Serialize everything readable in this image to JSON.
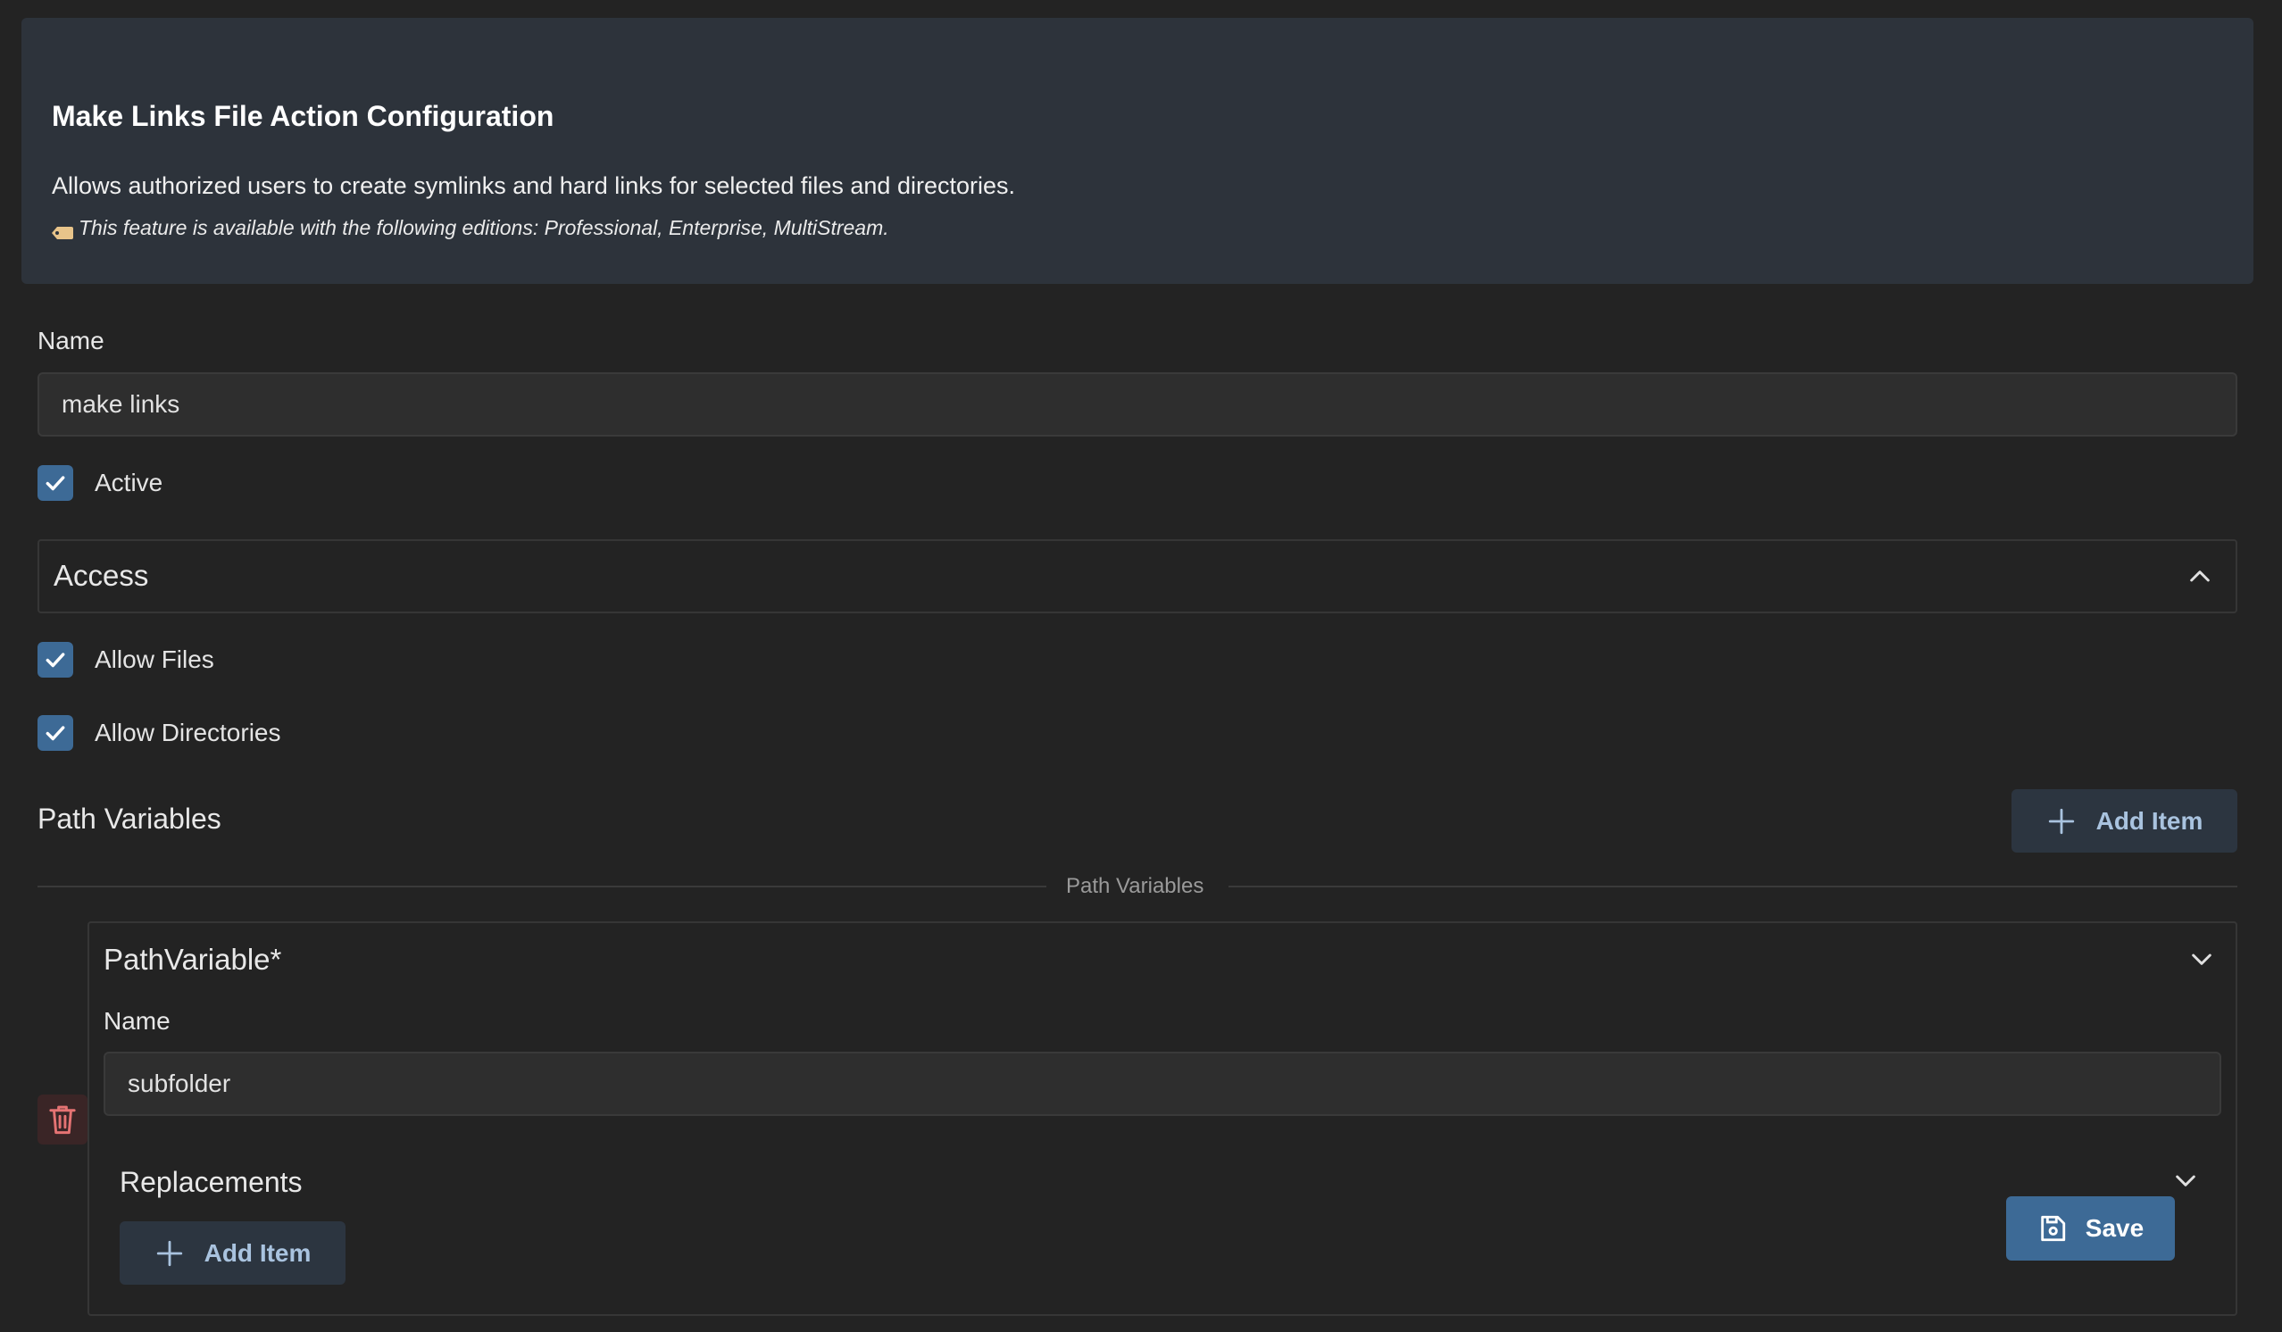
{
  "header": {
    "title": "Make Links File Action Configuration",
    "description": "Allows authorized users to create symlinks and hard links for selected files and directories.",
    "editions_note": "This feature is available with the following editions: Professional, Enterprise, MultiStream.",
    "note_icon": "tag-icon"
  },
  "form": {
    "name_label": "Name",
    "name_value": "make links",
    "active_label": "Active",
    "active_checked": true
  },
  "access": {
    "title": "Access",
    "allow_files_label": "Allow Files",
    "allow_directories_label": "Allow Directories"
  },
  "path_variables": {
    "title": "Path Variables",
    "add_item_label": "Add Item",
    "divider_label": "Path Variables",
    "items": [
      {
        "title": "PathVariable*",
        "name_label": "Name",
        "name_value": "subfolder",
        "replacements_title": "Replacements",
        "add_item_label": "Add Item"
      }
    ]
  },
  "actions": {
    "save_label": "Save"
  },
  "colors": {
    "background": "#232323",
    "banner": "#2d333b",
    "accent": "#3d6a96",
    "danger": "#e57373"
  }
}
